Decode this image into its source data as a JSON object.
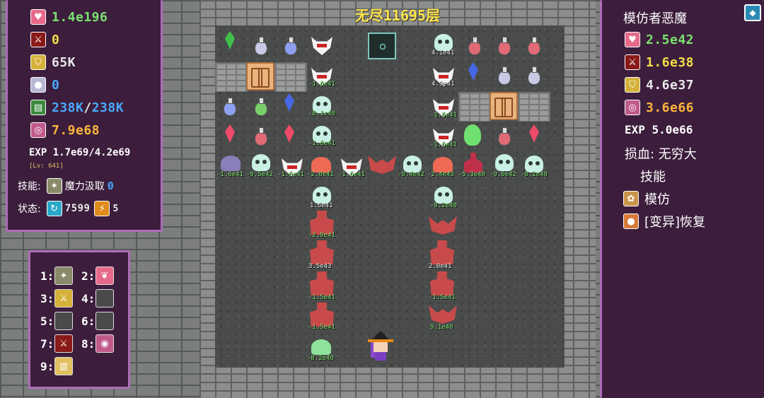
{
  "map": {
    "floor_title": "无尽11695层"
  },
  "player": {
    "hp": "1.4e196",
    "atk": "0",
    "def": "65K",
    "mdef": "0",
    "mp": "238K",
    "mp_max": "238K",
    "gold": "7.9e68",
    "exp": "EXP  1.7e69/4.2e69",
    "level": "[Lv: 641]",
    "skill_label": "技能:",
    "skill_name": "魔力汲取",
    "skill_value": "0",
    "status_label": "状态:",
    "status_value_1": "7599",
    "status_value_2": "5"
  },
  "hotkeys": {
    "k1": "1:",
    "k2": "2:",
    "k3": "3:",
    "k4": "4:",
    "k5": "5:",
    "k6": "6:",
    "k7": "7:",
    "k8": "8:",
    "k9": "9:"
  },
  "enemy": {
    "name": "模仿者恶魔",
    "hp": "2.5e42",
    "atk": "1.6e38",
    "def": "4.6e37",
    "gold": "3.6e66",
    "exp": "EXP  5.0e66",
    "damage": "损血: 无穷大",
    "skills_title": "技能",
    "skill_1": "模仿",
    "skill_2": "[变异]恢复"
  },
  "damage_labels": {
    "d1": "4.1e41",
    "d2": "-1.6e41",
    "d3": "4.9e41",
    "d4": "-8.1e40",
    "d5": "-1.6e41",
    "d6": "-1.6e41",
    "d7": "-1.6e41",
    "d8": "-9.5e42",
    "d9": "-1.6e41",
    "d10": "-2.0e41",
    "d11": "-1.6e41",
    "d12": "-9.4e42",
    "d13": "-2.4e43",
    "d14": "-5.3e40",
    "d15": "-9.6e42",
    "d16": "-8.2e40",
    "d17": "-1.6e41",
    "d18": "1.6e41",
    "d19": "-8.2e40",
    "d20": "-2.9e41",
    "d21": "3.5e43",
    "d22": "2.0e41",
    "d23": "-1.5e41",
    "d24": "-1.5e41",
    "d25": "-1.5e41",
    "d26": "9.1e40",
    "d27": "-8.2e40"
  },
  "colors": {
    "panel_bg": "#3c1e3c",
    "panel_border": "#b06cba",
    "title_yellow": "#ffe34a",
    "hp_green": "#7be36f",
    "mp_blue": "#4aa8ff",
    "gold_orange": "#ffb63a"
  }
}
